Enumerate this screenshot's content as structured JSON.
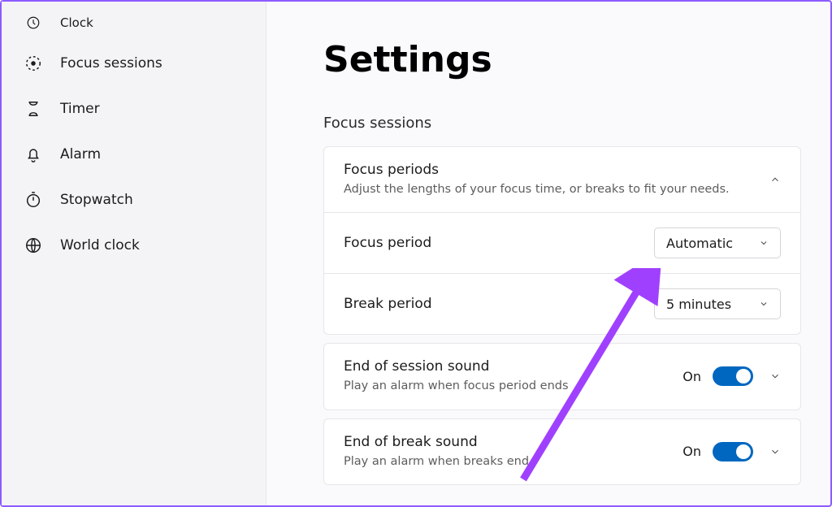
{
  "app_name": "Clock",
  "sidebar": {
    "items": [
      {
        "label": "Focus sessions"
      },
      {
        "label": "Timer"
      },
      {
        "label": "Alarm"
      },
      {
        "label": "Stopwatch"
      },
      {
        "label": "World clock"
      }
    ]
  },
  "page": {
    "title": "Settings",
    "section": "Focus sessions"
  },
  "focus_periods": {
    "title": "Focus periods",
    "desc": "Adjust the lengths of your focus time, or breaks to fit your needs.",
    "rows": {
      "focus_period": {
        "label": "Focus period",
        "value": "Automatic"
      },
      "break_period": {
        "label": "Break period",
        "value": "5 minutes"
      }
    }
  },
  "session_sound": {
    "title": "End of session sound",
    "desc": "Play an alarm when focus period ends",
    "state": "On"
  },
  "break_sound": {
    "title": "End of break sound",
    "desc": "Play an alarm when breaks end",
    "state": "On"
  },
  "colors": {
    "accent": "#0067c0",
    "annotation": "#a040ff"
  }
}
